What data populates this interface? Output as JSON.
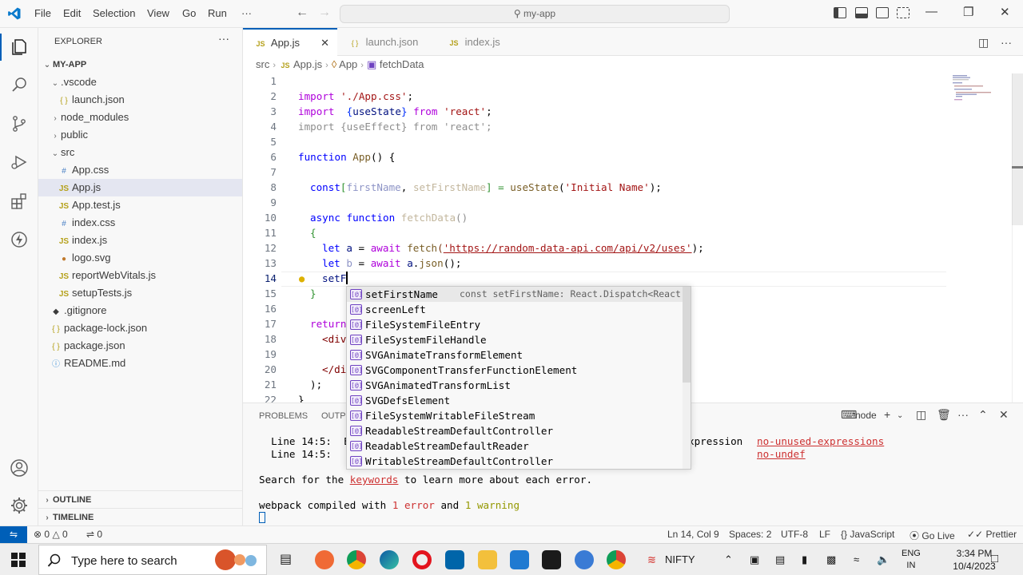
{
  "titlebar": {
    "menu": [
      "File",
      "Edit",
      "Selection",
      "View",
      "Go",
      "Run",
      "···"
    ],
    "search": "my-app"
  },
  "explorer": {
    "title": "EXPLORER",
    "more": "···",
    "root": "MY-APP",
    "tree": [
      {
        "label": ".vscode",
        "type": "folder",
        "open": true
      },
      {
        "label": "launch.json",
        "type": "json"
      },
      {
        "label": "node_modules",
        "type": "folder",
        "open": false
      },
      {
        "label": "public",
        "type": "folder",
        "open": false
      },
      {
        "label": "src",
        "type": "folder",
        "open": true
      },
      {
        "label": "App.css",
        "type": "css"
      },
      {
        "label": "App.js",
        "type": "js",
        "selected": true
      },
      {
        "label": "App.test.js",
        "type": "js"
      },
      {
        "label": "index.css",
        "type": "css"
      },
      {
        "label": "index.js",
        "type": "js"
      },
      {
        "label": "logo.svg",
        "type": "svg"
      },
      {
        "label": "reportWebVitals.js",
        "type": "js"
      },
      {
        "label": "setupTests.js",
        "type": "js"
      },
      {
        "label": ".gitignore",
        "type": "git"
      },
      {
        "label": "package-lock.json",
        "type": "json"
      },
      {
        "label": "package.json",
        "type": "json"
      },
      {
        "label": "README.md",
        "type": "info"
      }
    ],
    "outline": "OUTLINE",
    "timeline": "TIMELINE"
  },
  "tabs": [
    {
      "label": "App.js",
      "icon": "JS",
      "active": true
    },
    {
      "label": "launch.json",
      "icon": "{ }",
      "active": false
    },
    {
      "label": "index.js",
      "icon": "JS",
      "active": false
    }
  ],
  "breadcrumb": [
    "src",
    "App.js",
    "App",
    "fetchData"
  ],
  "editor": {
    "lines": [
      "1",
      "2",
      "3",
      "4",
      "5",
      "6",
      "7",
      "8",
      "9",
      "10",
      "11",
      "12",
      "13",
      "14",
      "15",
      "16",
      "17",
      "18",
      "19",
      "20",
      "21",
      "22"
    ],
    "code": {
      "l2a": "import",
      "l2b": "'./App.css'",
      "l2c": ";",
      "l3a": "import",
      "l3b": "{",
      "l3c": "useState",
      "l3d": "}",
      "l3e": "from",
      "l3f": "'react'",
      "l3g": ";",
      "l4": "import {useEffect} from 'react';",
      "l6a": "function",
      "l6b": "App",
      "l6c": "() {",
      "l8a": "const",
      "l8b": "[",
      "l8c": "firstName",
      "l8d": ", ",
      "l8e": "setFirstName",
      "l8f": "] = ",
      "l8g": "useState",
      "l8h": "(",
      "l8i": "'Initial Name'",
      "l8j": ");",
      "l10a": "async",
      "l10b": "function",
      "l10c": "fetchData",
      "l10d": "()",
      "l11": "{",
      "l12a": "let",
      "l12b": "a",
      "l12c": " = ",
      "l12d": "await",
      "l12e": "fetch",
      "l12f": "(",
      "l12g": "'https://random-data-api.com/api/v2/uses'",
      "l12h": ");",
      "l13a": "let",
      "l13b": "b",
      "l13c": " = ",
      "l13d": "await",
      "l13e": "a",
      "l13f": ".",
      "l13g": "json",
      "l13h": "();",
      "l14": "setF",
      "l15": "}",
      "l17": "return",
      "l18": "<div",
      "l20": "</di",
      "l21": ");",
      "l22": "}"
    }
  },
  "suggest": {
    "detail": "const setFirstName: React.Dispatch<React...",
    "items": [
      "setFirstName",
      "screenLeft",
      "FileSystemFileEntry",
      "FileSystemFileHandle",
      "SVGAnimateTransformElement",
      "SVGComponentTransferFunctionElement",
      "SVGAnimatedTransformList",
      "SVGDefsElement",
      "FileSystemWritableFileStream",
      "ReadableStreamDefaultController",
      "ReadableStreamDefaultReader",
      "WritableStreamDefaultController"
    ]
  },
  "panel": {
    "tabs": [
      "PROBLEMS",
      "OUTPU"
    ],
    "terminal_name": "node",
    "lines": {
      "e1a": "Line 14:5:  E",
      "e1b": "xpression",
      "e1c": "no-unused-expressions",
      "e2a": "Line 14:5:  '",
      "e2b": "no-undef",
      "s1": "Search for the ",
      "s2": "keywords",
      "s3": " to learn more about each error.",
      "w1": "webpack compiled with ",
      "w2": "1 error",
      "w3": " and ",
      "w4": "1 warning"
    }
  },
  "statusbar": {
    "errors": "0",
    "warnings": "0",
    "ports": "0",
    "position": "Ln 14, Col 9",
    "spaces": "Spaces: 2",
    "encoding": "UTF-8",
    "eol": "LF",
    "language": "JavaScript",
    "golive": "Go Live",
    "prettier": "Prettier"
  },
  "taskbar": {
    "search_placeholder": "Type here to search",
    "stock": "NIFTY",
    "lang1": "ENG",
    "lang2": "IN",
    "time": "3:34 PM",
    "date": "10/4/2023"
  },
  "colors": {
    "accent": "#005fb8",
    "keyword": "#0000ff",
    "control": "#af00db",
    "string": "#a31515",
    "function": "#795e26",
    "variable": "#001080",
    "error": "#cd3131"
  }
}
